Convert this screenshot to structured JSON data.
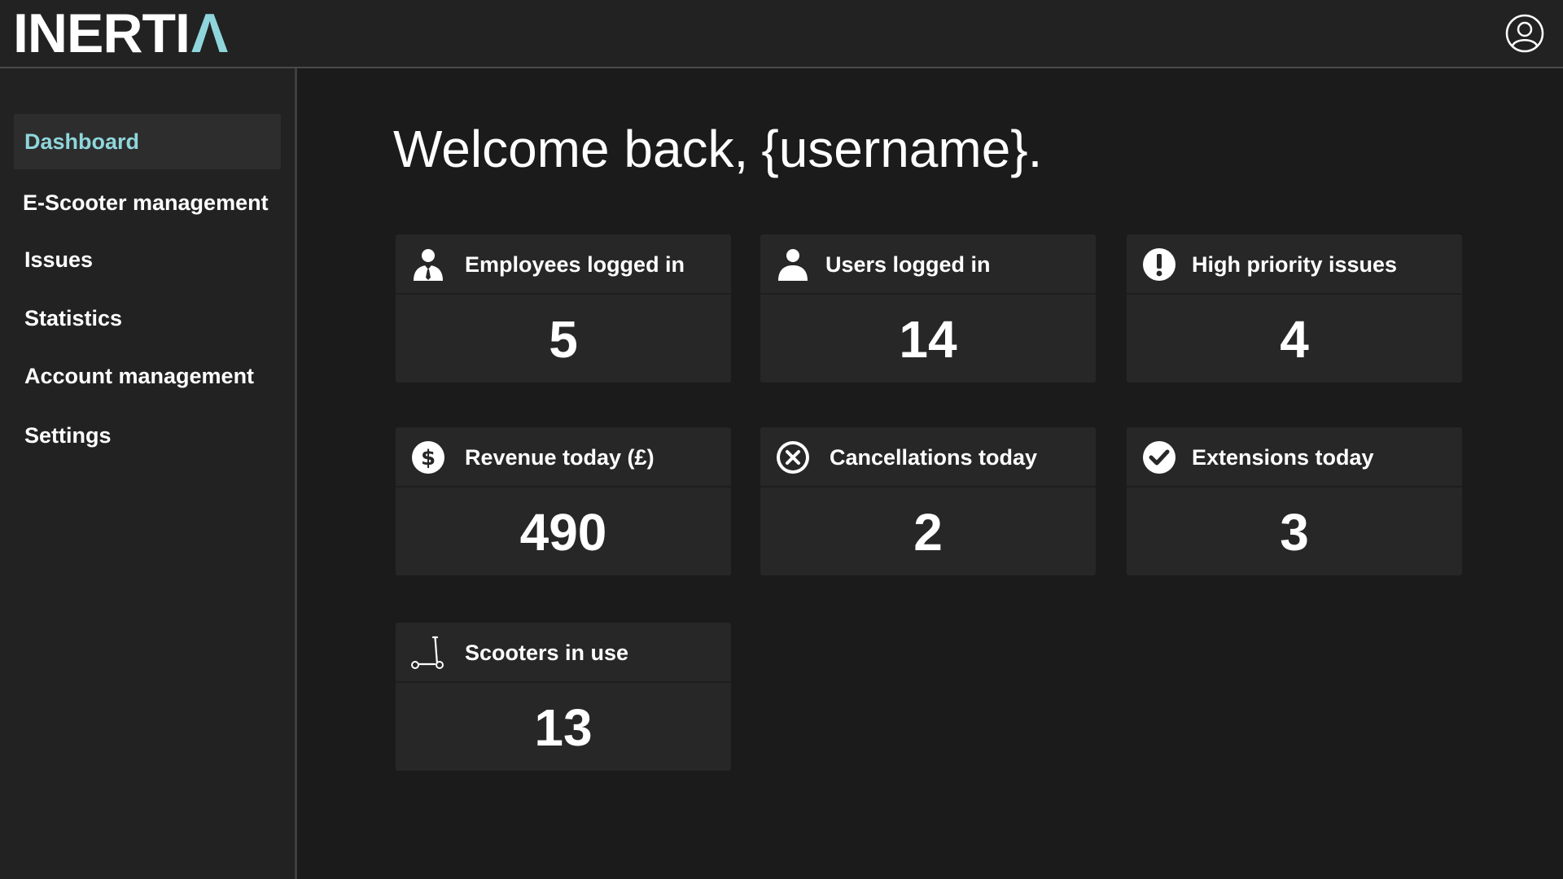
{
  "app": {
    "logo_text": "INERTI",
    "logo_accent": "Λ",
    "accent_color": "#8fd6dc"
  },
  "header": {
    "profile_icon": "user-circle-icon"
  },
  "sidebar": {
    "items": [
      {
        "label": "Dashboard",
        "active": true
      },
      {
        "label": "E-Scooter management",
        "active": false
      },
      {
        "label": "Issues",
        "active": false
      },
      {
        "label": "Statistics",
        "active": false
      },
      {
        "label": "Account management",
        "active": false
      },
      {
        "label": "Settings",
        "active": false
      }
    ]
  },
  "main": {
    "welcome_prefix": "Welcome back,",
    "welcome_name": "{username}."
  },
  "cards": [
    {
      "title": "Employees logged in",
      "value": "5",
      "icon": "employee-icon"
    },
    {
      "title": "Users logged in",
      "value": "14",
      "icon": "user-icon"
    },
    {
      "title": "High priority issues",
      "value": "4",
      "icon": "exclamation-circle-icon"
    },
    {
      "title": "Revenue today (£)",
      "value": "490",
      "icon": "dollar-circle-icon"
    },
    {
      "title": "Cancellations today",
      "value": "2",
      "icon": "x-circle-icon"
    },
    {
      "title": "Extensions today",
      "value": "3",
      "icon": "check-circle-icon"
    },
    {
      "title": "Scooters in use",
      "value": "13",
      "icon": "scooter-icon"
    }
  ]
}
